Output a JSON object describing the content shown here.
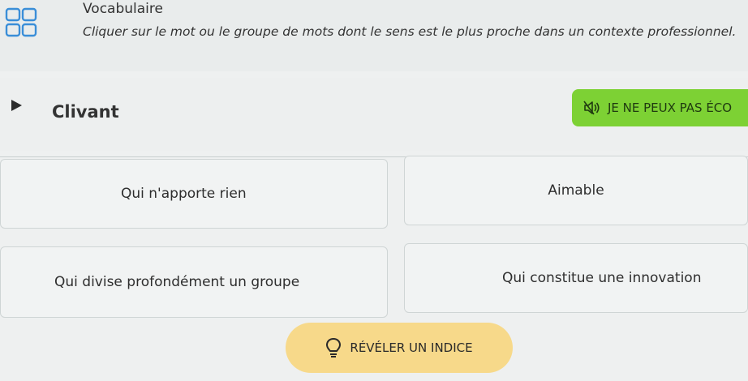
{
  "header": {
    "title": "Vocabulaire",
    "instruction": "Cliquer sur le mot ou le groupe de mots dont le sens est le plus proche dans un contexte professionnel."
  },
  "exercise": {
    "word": "Clivant",
    "cant_listen_label": "JE NE PEUX PAS ÉCO"
  },
  "options": [
    {
      "label": "Qui n'apporte rien"
    },
    {
      "label": "Aimable"
    },
    {
      "label": "Qui divise profondément un groupe"
    },
    {
      "label": "Qui constitue une innovation"
    }
  ],
  "hint_button": {
    "label": "RÉVÉLER UN INDICE"
  },
  "colors": {
    "accent_green": "#7dd134",
    "hint_yellow": "#f7d98a"
  },
  "icons": {
    "app": "grid-icon",
    "play": "play-icon",
    "audio": "speaker-muted-icon",
    "hint": "lightbulb-icon"
  }
}
